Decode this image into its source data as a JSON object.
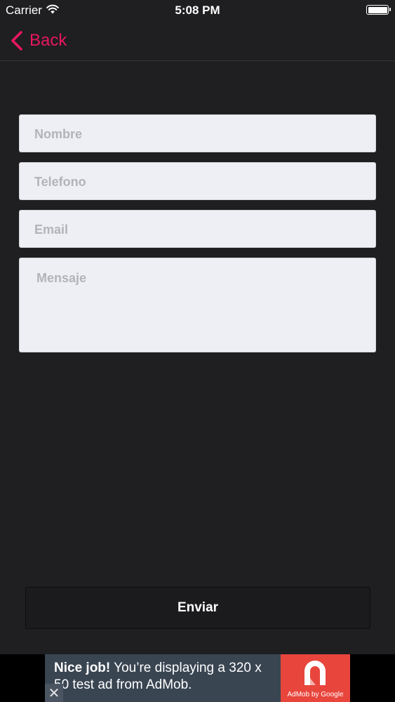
{
  "status_bar": {
    "carrier": "Carrier",
    "time": "5:08 PM",
    "battery_level": 1.0
  },
  "nav": {
    "back_label": "Back",
    "accent_color": "#e8175d"
  },
  "form": {
    "nombre_placeholder": "Nombre",
    "telefono_placeholder": "Telefono",
    "email_placeholder": "Email",
    "mensaje_placeholder": "Mensaje",
    "submit_label": "Enviar"
  },
  "ad": {
    "headline": "Nice job!",
    "body": "You’re displaying a 320 x 50 test ad from AdMob.",
    "brand": "AdMob by Google",
    "close_symbol": "✕"
  },
  "icons": {
    "back": "chevron-left-icon",
    "wifi": "wifi-icon",
    "battery": "battery-icon",
    "ad_logo": "admob-logo",
    "close": "close-icon"
  }
}
